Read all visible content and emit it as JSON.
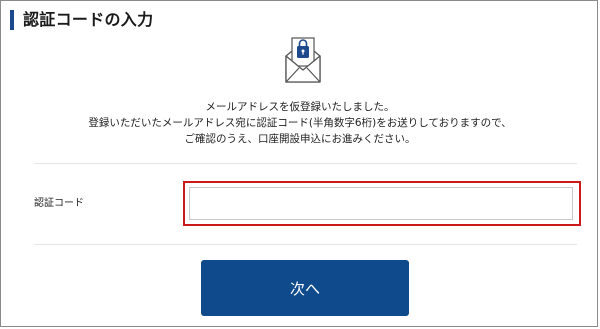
{
  "page": {
    "title": "認証コードの入力"
  },
  "icon": {
    "name": "mail-lock-icon",
    "accent_color": "#1d4a8c"
  },
  "message": {
    "line1": "メールアドレスを仮登録いたしました。",
    "line2": "登録いただいたメールアドレス宛に認証コード(半角数字6桁)をお送りしておりますので、",
    "line3": "ご確認のうえ、口座開設申込にお進みください。"
  },
  "form": {
    "code_label": "認証コード",
    "code_value": "",
    "highlight_color": "#cc1a1a"
  },
  "actions": {
    "next_label": "次へ",
    "button_color": "#0f4a8c"
  }
}
